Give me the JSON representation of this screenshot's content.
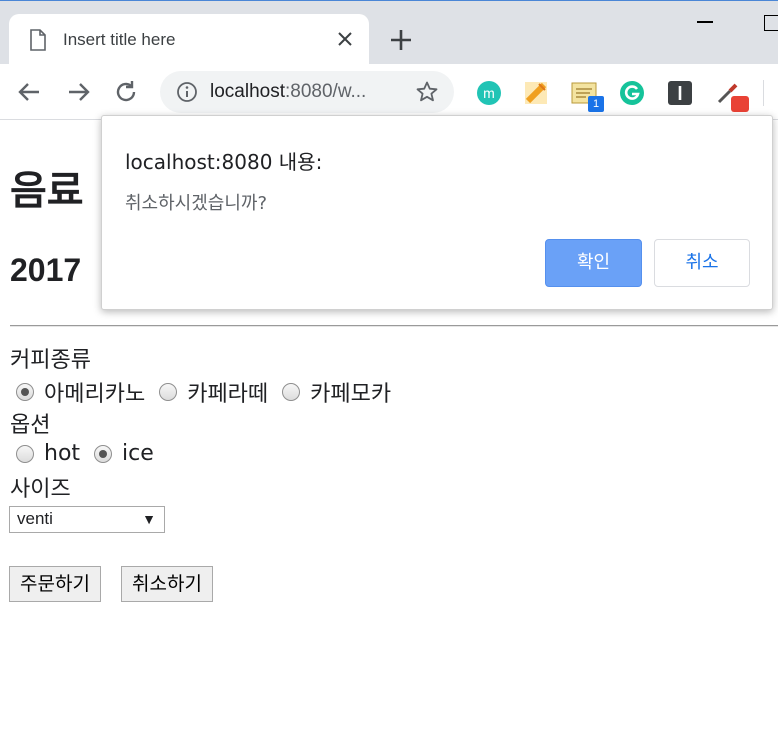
{
  "browser": {
    "tab_title": "Insert title here",
    "url_host": "localhost",
    "url_rest": ":8080/w..."
  },
  "page": {
    "heading": "음료",
    "subheading": "2017",
    "coffee_label": "커피종류",
    "coffee_options": [
      {
        "label": "아메리카노",
        "checked": true
      },
      {
        "label": "카페라떼",
        "checked": false
      },
      {
        "label": "카페모카",
        "checked": false
      }
    ],
    "option_label": "옵션",
    "temp_options": [
      {
        "label": "hot",
        "checked": false
      },
      {
        "label": "ice",
        "checked": true
      }
    ],
    "size_label": "사이즈",
    "size_selected": "venti",
    "order_button": "주문하기",
    "cancel_button": "취소하기"
  },
  "dialog": {
    "title": "localhost:8080 내용:",
    "message": "취소하시겠습니까?",
    "ok_label": "확인",
    "cancel_label": "취소"
  },
  "extensions": {
    "badge_count": "1",
    "icons": [
      "m-icon",
      "pencil-icon",
      "note-icon",
      "grammarly-icon",
      "i-icon",
      "eyedropper-icon"
    ]
  },
  "colors": {
    "dialog_ok_bg": "#6aa1f7",
    "dialog_cancel_text": "#1a73e8"
  }
}
